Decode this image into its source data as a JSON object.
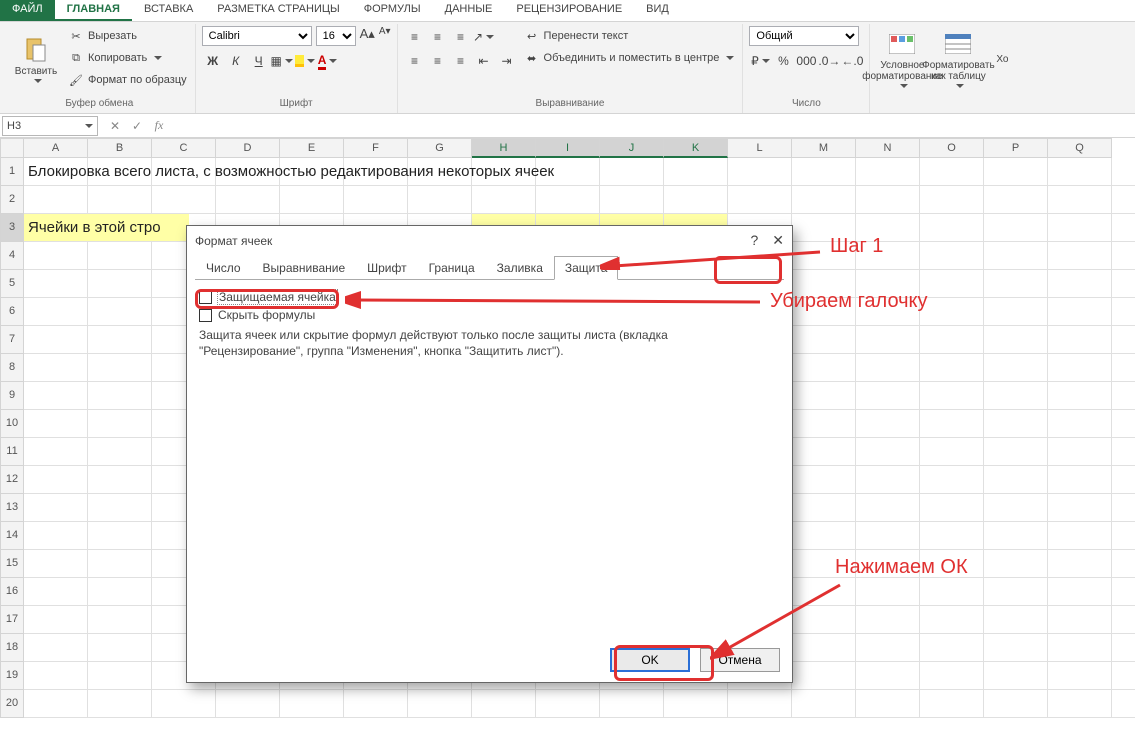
{
  "tabs": {
    "file": "ФАЙЛ",
    "items": [
      "ГЛАВНАЯ",
      "ВСТАВКА",
      "РАЗМЕТКА СТРАНИЦЫ",
      "ФОРМУЛЫ",
      "ДАННЫЕ",
      "РЕЦЕНЗИРОВАНИЕ",
      "ВИД"
    ],
    "active": 0
  },
  "ribbon": {
    "clipboard": {
      "paste": "Вставить",
      "cut": "Вырезать",
      "copy": "Копировать",
      "format_painter": "Формат по образцу",
      "title": "Буфер обмена"
    },
    "font": {
      "name": "Calibri",
      "size": "16",
      "title": "Шрифт",
      "bold": "Ж",
      "italic": "К",
      "underline": "Ч"
    },
    "align": {
      "wrap": "Перенести текст",
      "merge": "Объединить и поместить в центре",
      "title": "Выравнивание"
    },
    "number": {
      "format": "Общий",
      "title": "Число",
      "percent": "%",
      "comma": "000"
    },
    "styles": {
      "cond": "Условное\nформатирование",
      "table": "Форматировать\nкак таблицу"
    },
    "other_visible": "Хо"
  },
  "formula_bar": {
    "name": "H3",
    "value": ""
  },
  "columns": [
    "A",
    "B",
    "C",
    "D",
    "E",
    "F",
    "G",
    "H",
    "I",
    "J",
    "K",
    "L",
    "M",
    "N",
    "O",
    "P",
    "Q"
  ],
  "selected_cols_start": 7,
  "selected_cols_end": 10,
  "rows_count": 20,
  "selected_row": 3,
  "row1_text": "Блокировка всего листа, с возможностью редактирования некоторых ячеек",
  "row3_text": "Ячейки в этой стро",
  "dialog": {
    "title": "Формат ячеек",
    "help": "?",
    "close": "✕",
    "tabs": [
      "Число",
      "Выравнивание",
      "Шрифт",
      "Граница",
      "Заливка",
      "Защита"
    ],
    "active_tab": 5,
    "chk_locked": "Защищаемая ячейка",
    "chk_hidden": "Скрыть формулы",
    "hint": "Защита ячеек или скрытие формул действуют только после защиты листа (вкладка \"Рецензирование\", группа \"Изменения\", кнопка \"Защитить лист\").",
    "ok": "OK",
    "cancel": "Отмена"
  },
  "annotations": {
    "step1": "Шаг 1",
    "uncheck": "Убираем галочку",
    "press_ok": "Нажимаем ОК"
  }
}
